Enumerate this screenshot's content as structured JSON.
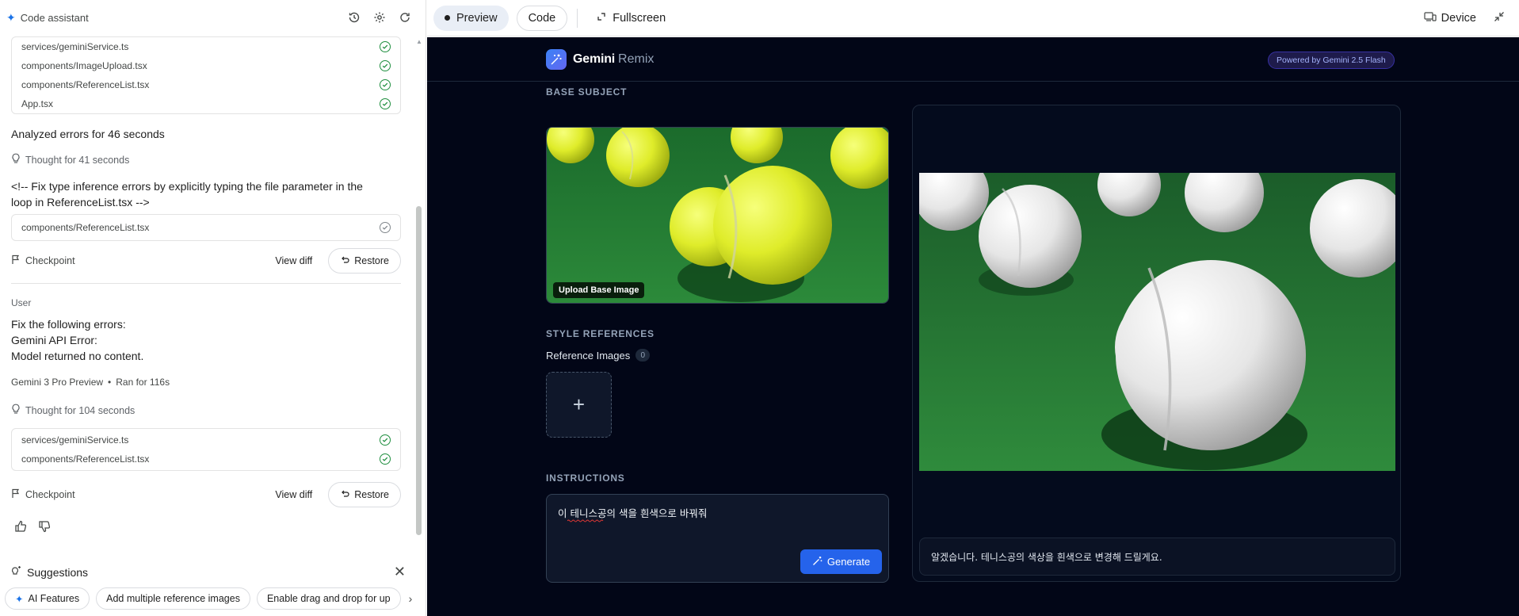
{
  "left_panel": {
    "title": "Code assistant",
    "files_top": [
      {
        "name": "services/geminiService.ts"
      },
      {
        "name": "components/ImageUpload.tsx"
      },
      {
        "name": "components/ReferenceList.tsx"
      },
      {
        "name": "App.tsx"
      }
    ],
    "analyzed": "Analyzed errors for 46 seconds",
    "thought1": "Thought for 41 seconds",
    "comment_line1": "<!-- Fix type inference errors by explicitly typing the file parameter in the",
    "comment_line2": "loop in ReferenceList.tsx -->",
    "file_single": "components/ReferenceList.tsx",
    "checkpoint_label": "Checkpoint",
    "view_diff": "View diff",
    "restore": "Restore",
    "user_label": "User",
    "user_msg": [
      "Fix the following errors:",
      "Gemini API Error:",
      "Model returned no content."
    ],
    "model_line": "Gemini 3 Pro Preview",
    "ran_for": "Ran for 116s",
    "thought2": "Thought for 104 seconds",
    "files_bottom": [
      {
        "name": "services/geminiService.ts"
      },
      {
        "name": "components/ReferenceList.tsx"
      }
    ],
    "suggestions_title": "Suggestions",
    "chips": [
      "AI Features",
      "Add multiple reference images",
      "Enable drag and drop for up"
    ]
  },
  "topbar": {
    "preview": "Preview",
    "code": "Code",
    "fullscreen": "Fullscreen",
    "device": "Device"
  },
  "app": {
    "brand": "Gemini",
    "brand_suffix": "Remix",
    "powered": "Powered by Gemini 2.5 Flash",
    "base_subject": "BASE SUBJECT",
    "upload_badge": "Upload Base Image",
    "style_references": "STYLE REFERENCES",
    "reference_images": "Reference Images",
    "reference_count": "0",
    "instructions": "INSTRUCTIONS",
    "instruction_text": "이 테니스공의 색을 흰색으로 바꿔줘",
    "generate": "Generate",
    "result_message": "알겠습니다. 테니스공의 색상을 흰색으로 변경해 드릴게요."
  },
  "colors": {
    "accent": "#2563eb",
    "app_bg": "#020617",
    "check_green": "#1e8e3e"
  }
}
